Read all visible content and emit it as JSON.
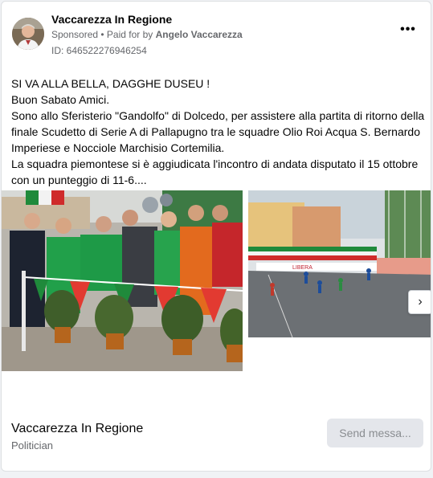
{
  "header": {
    "page_name": "Vaccarezza In Regione",
    "sponsored": "Sponsored",
    "dot": " • ",
    "paid_for_prefix": "Paid for by ",
    "paid_for_name": "Angelo Vaccarezza",
    "ad_id": "ID: 646522276946254",
    "more_icon": "more-horizontal-icon"
  },
  "post": {
    "lines": [
      "SI VA ALLA BELLA, DAGGHE DUSEU !",
      "Buon Sabato Amici.",
      "Sono allo Sferisterio \"Gandolfo\" di Dolcedo, per assistere alla partita di ritorno della",
      "finale Scudetto di Serie A di Pallapugno tra le squadre Olio Roi Acqua S. Bernardo",
      "Imperiese e Nocciole Marchisio Cortemilia.",
      "La squadra piemontese si è aggiudicata l'incontro di andata disputato il 15 ottobre",
      "con un punteggio di 11-6...."
    ]
  },
  "carousel": {
    "next_icon": "chevron-right-icon",
    "banner_sign_text": "LIBERA"
  },
  "footer": {
    "page_name": "Vaccarezza In Regione",
    "category": "Politician",
    "send_button": "Send messa..."
  },
  "colors": {
    "primary_text": "#050505",
    "secondary_text": "#65676b",
    "button_bg": "#e4e6eb",
    "button_text": "#8a8d91"
  }
}
